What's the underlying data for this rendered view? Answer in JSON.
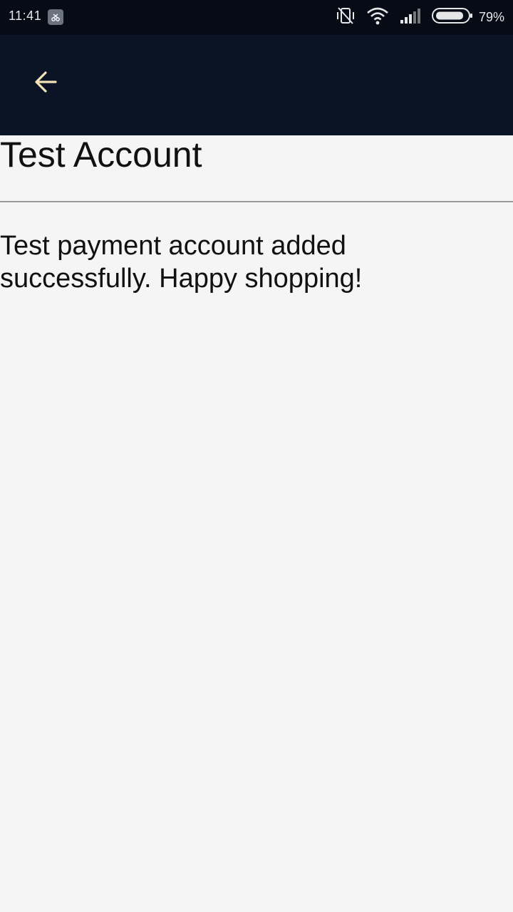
{
  "status_bar": {
    "time": "11:41",
    "battery": "79%",
    "icons": [
      "app-notification-icon",
      "vibrate-off-icon",
      "wifi-icon",
      "signal-icon",
      "battery-icon"
    ]
  },
  "app_bar": {
    "back_icon": "arrow-left-icon",
    "colors": {
      "background": "#0a1424",
      "icon": "#f3e2b8"
    }
  },
  "page": {
    "title": "Test Account",
    "message": "Test payment account added successfully. Happy shopping!"
  }
}
